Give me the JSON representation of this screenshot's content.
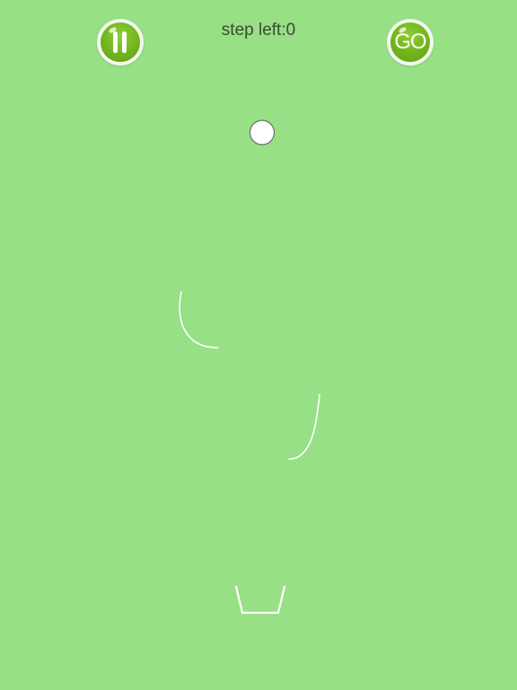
{
  "colors": {
    "background": "#97e085",
    "line": "#ffffff",
    "ball_fill": "#ffffff",
    "ball_outline": "#6f6f6f",
    "button_green": "#72b41e"
  },
  "hud": {
    "pause_icon": "pause-icon",
    "steps_label": "step left:0",
    "go_label": "GO"
  },
  "game": {
    "objects": [
      "ball",
      "curved-ramp",
      "curved-ramp",
      "cup-goal"
    ]
  }
}
